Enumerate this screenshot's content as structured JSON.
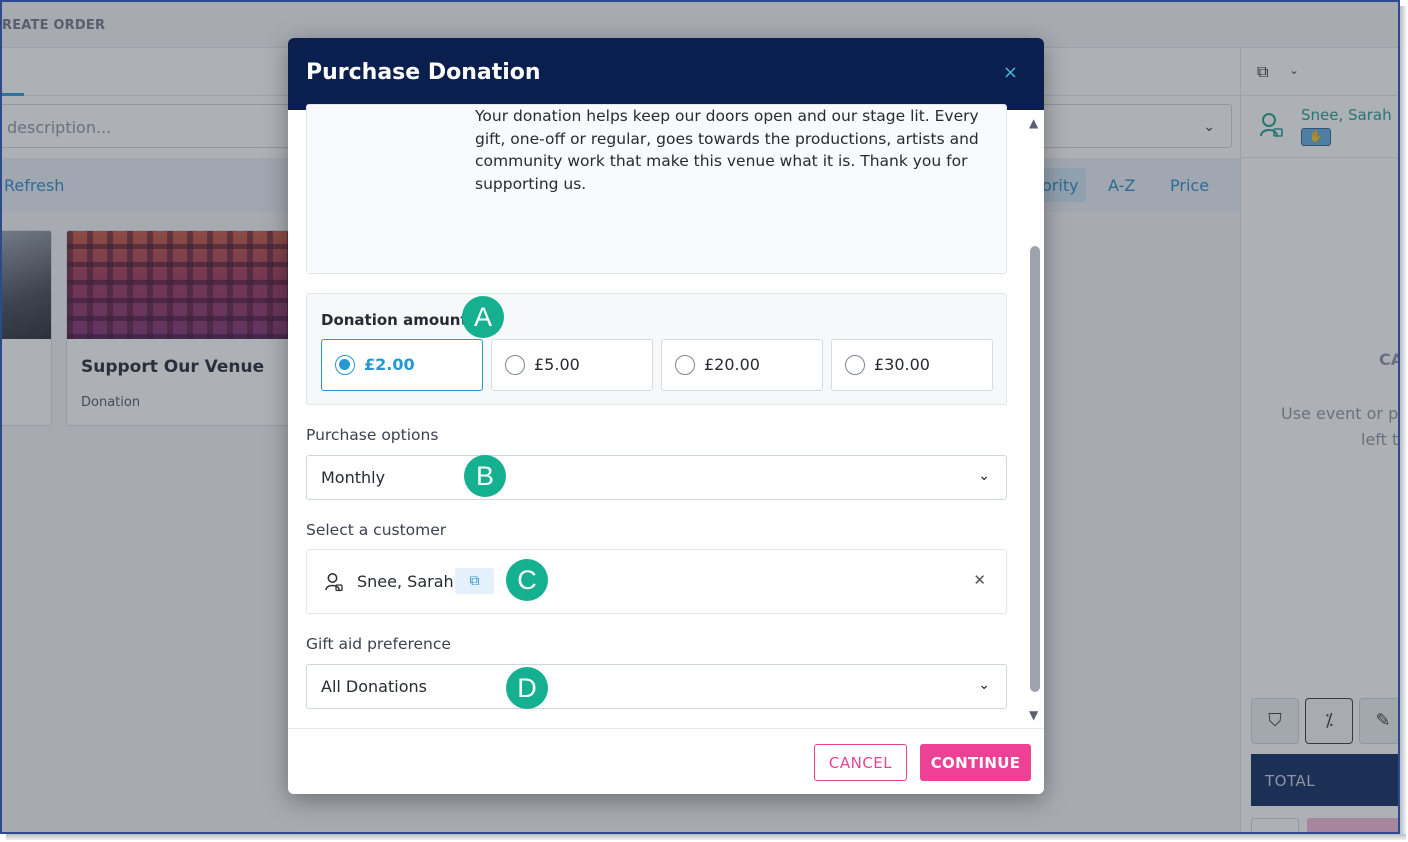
{
  "app": {
    "breadcrumb": "REATE ORDER",
    "search_placeholder": "description...",
    "toolbar": {
      "refresh": "Refresh",
      "sort_priority": "ority",
      "sort_az": "A-Z",
      "sort_price": "Price"
    },
    "cards": [
      {
        "title": "",
        "subtitle": ""
      },
      {
        "title": "Support Our Venue",
        "subtitle": "Donation"
      }
    ],
    "right_panel": {
      "customer_name": "Snee, Sarah",
      "empty_title": "CA",
      "empty_line1": "Use event or p",
      "empty_line2": "left t",
      "total_label": "TOTAL"
    }
  },
  "modal": {
    "title": "Purchase Donation",
    "close_glyph": "×",
    "description": "Your donation helps keep our doors open and our stage lit. Every gift, one-off or regular, goes towards the productions, artists and community work that make this venue what it is. Thank you for supporting us.",
    "donation_amount": {
      "label": "Donation amount",
      "required_mark": "*",
      "selected_index": 0,
      "options": [
        "£2.00",
        "£5.00",
        "£20.00",
        "£30.00"
      ]
    },
    "purchase_options": {
      "label": "Purchase options",
      "value": "Monthly"
    },
    "customer": {
      "label": "Select a customer",
      "name": "Snee, Sarah"
    },
    "gift_aid": {
      "label": "Gift aid preference",
      "value": "All Donations"
    },
    "buttons": {
      "cancel": "CANCEL",
      "continue": "CONTINUE"
    }
  },
  "markers": [
    "A",
    "B",
    "C",
    "D"
  ],
  "colors": {
    "header_navy": "#0b1f4f",
    "accent_blue": "#2597d4",
    "accent_pink": "#ec4195",
    "marker_green": "#14b08f",
    "customer_teal": "#1a9c8d"
  }
}
